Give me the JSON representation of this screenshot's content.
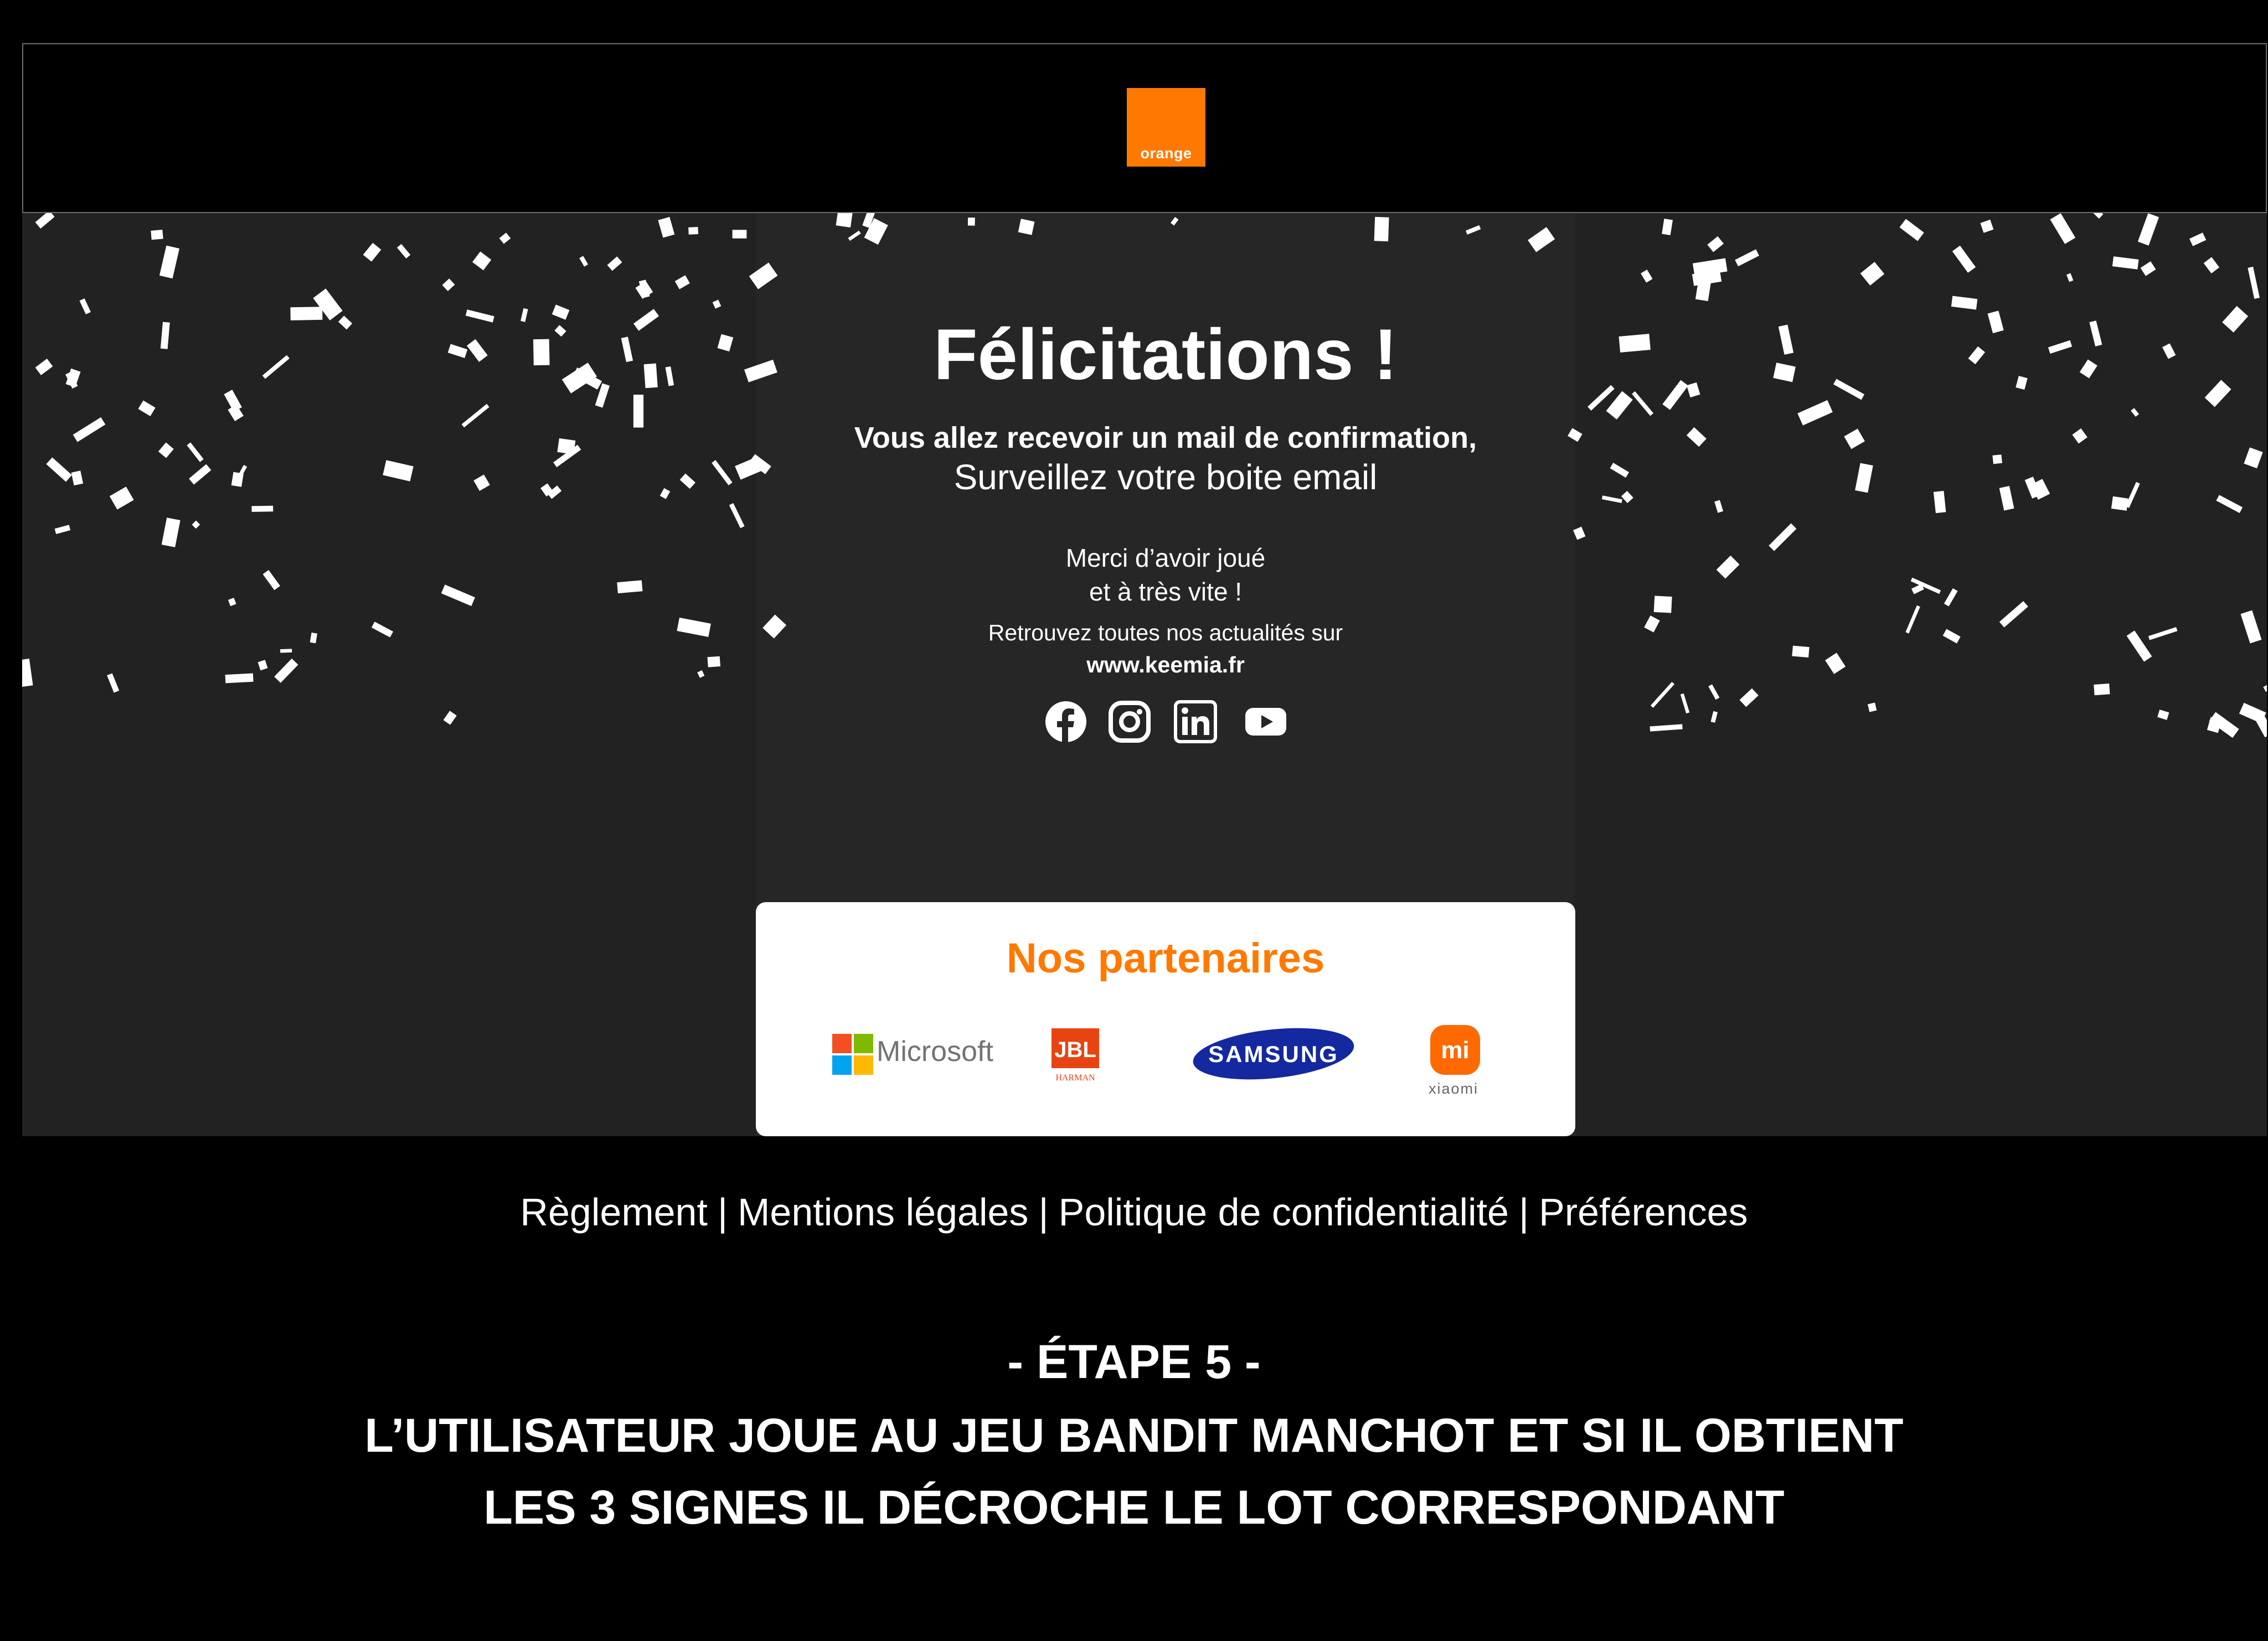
{
  "header": {
    "logo_text": "orange",
    "brand_color": "#ff7900"
  },
  "confirmation": {
    "title": "Félicitations !",
    "line_bold": "Vous allez recevoir un mail de confirmation,",
    "line_regular": "Surveillez votre boite email",
    "thanks_line1": "Merci d’avoir joué",
    "thanks_line2": "et à très vite !",
    "news_label": "Retrouvez toutes nos actualités sur",
    "website": "www.keemia.fr"
  },
  "social_icons": [
    "facebook-icon",
    "instagram-icon",
    "linkedin-icon",
    "youtube-icon"
  ],
  "partners": {
    "title": "Nos partenaires",
    "logos": [
      {
        "icon": "microsoft-logo",
        "text": "Microsoft"
      },
      {
        "icon": "jbl-logo",
        "text": "JBL",
        "subtext": "HARMAN"
      },
      {
        "icon": "samsung-logo",
        "text": "SAMSUNG"
      },
      {
        "icon": "xiaomi-logo",
        "text": "mi",
        "subtext": "xiaomi"
      }
    ]
  },
  "footer": {
    "links": [
      "Règlement",
      "Mentions légales",
      "Politique de confidentialité",
      "Préférences"
    ],
    "separator": "|"
  },
  "caption": {
    "step": "- ÉTAPE 5 -",
    "line1": "L’UTILISATEUR JOUE AU JEU BANDIT MANCHOT ET SI IL OBTIENT",
    "line2": "LES 3 SIGNES IL DÉCROCHE LE LOT CORRESPONDANT"
  },
  "colors": {
    "background": "#000000",
    "stage": "#222222",
    "panel": "#262626",
    "accent": "#ff7900",
    "text": "#ffffff",
    "confetti": "#ffffff"
  }
}
